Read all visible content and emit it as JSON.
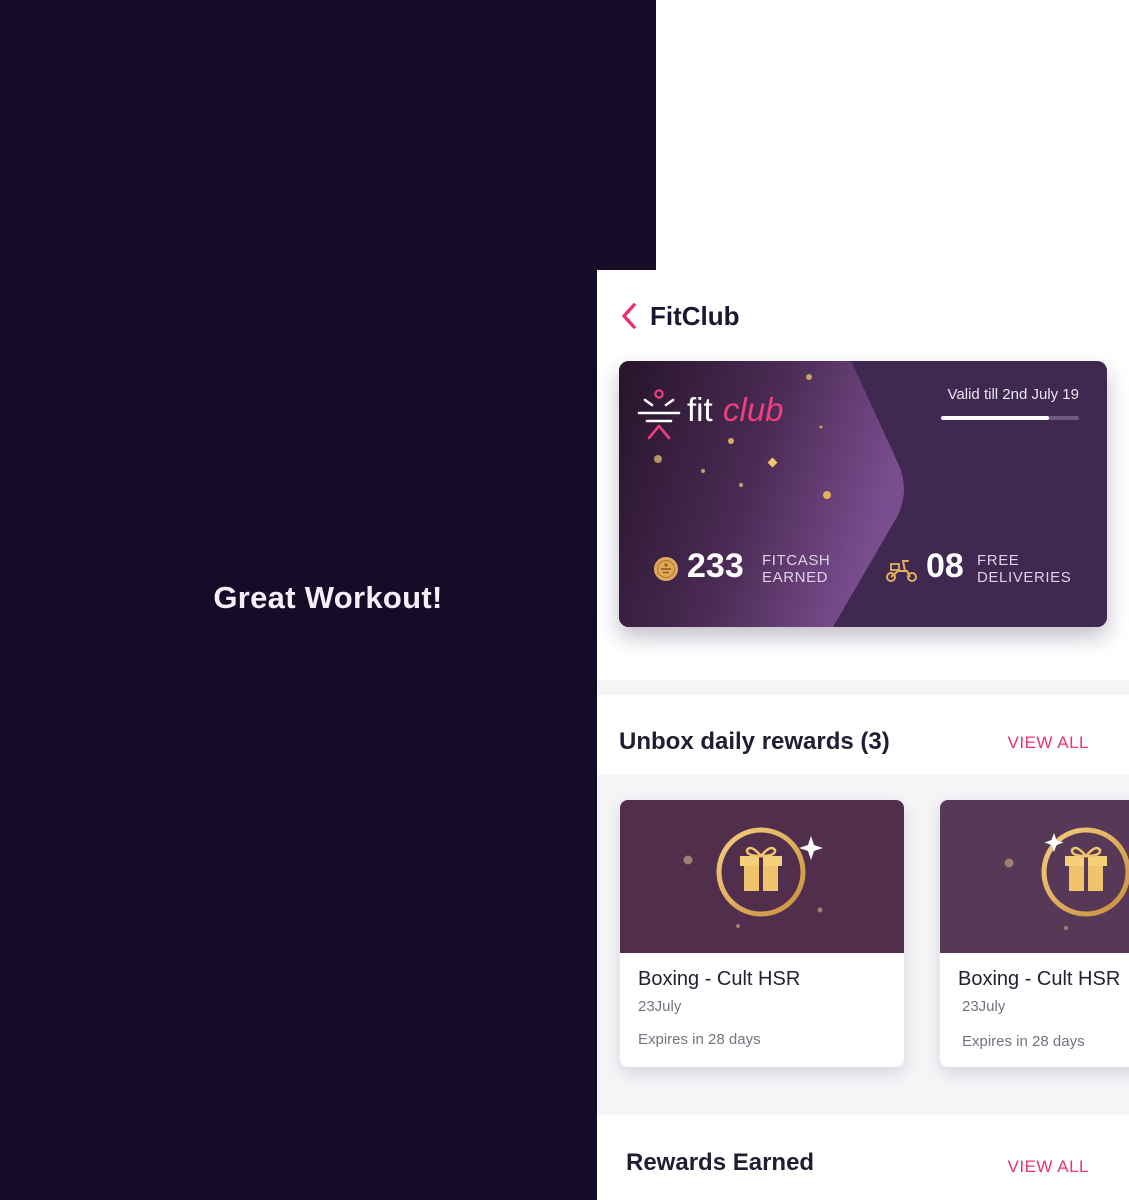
{
  "left_panel": {
    "headline": "Great Workout!",
    "background_color": "#150c28"
  },
  "header": {
    "title": "FitClub",
    "back_icon": "chevron-left-icon"
  },
  "fitclub_card": {
    "logo_fit": "fit",
    "logo_club": "club",
    "valid_text": "Valid till 2nd July 19",
    "validity_progress": 0.78,
    "fitcash": {
      "value": "233",
      "label_line1": "FITCASH",
      "label_line2": "EARNED",
      "icon": "coin-icon"
    },
    "deliveries": {
      "value": "08",
      "label_line1": "FREE",
      "label_line2": "DELIVERIES",
      "icon": "scooter-icon"
    }
  },
  "daily_rewards": {
    "title": "Unbox daily rewards (3)",
    "view_all": "VIEW ALL",
    "cards": [
      {
        "title": "Boxing - Cult HSR",
        "date": "23July",
        "expires": "Expires in 28 days",
        "icon": "gift-icon"
      },
      {
        "title": "Boxing - Cult HSR",
        "date": "23July",
        "expires": "Expires in 28 days",
        "icon": "gift-icon"
      }
    ]
  },
  "rewards_earned": {
    "title": "Rewards Earned",
    "view_all": "VIEW ALL"
  },
  "colors": {
    "accent": "#e8346f",
    "card_purple": "#3f2950",
    "gold": "#e3b15a"
  }
}
